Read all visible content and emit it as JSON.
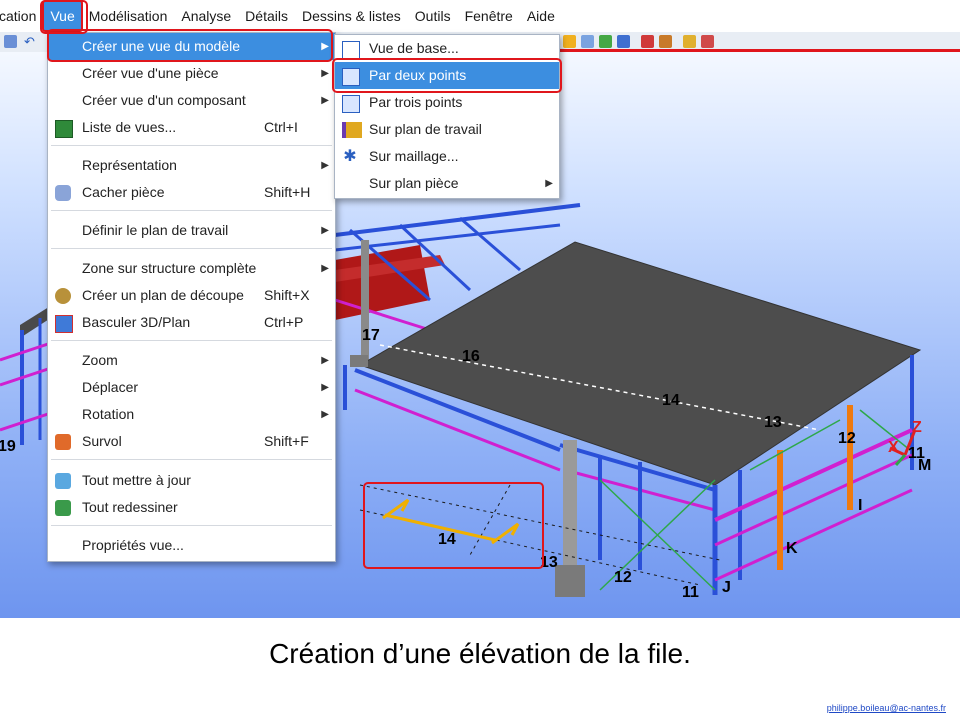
{
  "menubar": {
    "items": [
      "cation",
      "Vue",
      "Modélisation",
      "Analyse",
      "Détails",
      "Dessins & listes",
      "Outils",
      "Fenêtre",
      "Aide"
    ]
  },
  "vue_menu": {
    "items": [
      {
        "label": "Créer une vue du modèle",
        "shortcut": "",
        "arrow": "▶"
      },
      {
        "label": "Créer vue d'une pièce",
        "shortcut": "",
        "arrow": "▶"
      },
      {
        "label": "Créer vue d'un composant",
        "shortcut": "",
        "arrow": "▶"
      },
      {
        "label": "Liste de vues...",
        "shortcut": "Ctrl+I",
        "arrow": ""
      },
      {
        "label": "Représentation",
        "shortcut": "",
        "arrow": "▶"
      },
      {
        "label": "Cacher pièce",
        "shortcut": "Shift+H",
        "arrow": ""
      },
      {
        "label": "Définir le plan de travail",
        "shortcut": "",
        "arrow": "▶"
      },
      {
        "label": "Zone sur structure complète",
        "shortcut": "",
        "arrow": "▶"
      },
      {
        "label": "Créer un plan de découpe",
        "shortcut": "Shift+X",
        "arrow": ""
      },
      {
        "label": "Basculer 3D/Plan",
        "shortcut": "Ctrl+P",
        "arrow": ""
      },
      {
        "label": "Zoom",
        "shortcut": "",
        "arrow": "▶"
      },
      {
        "label": "Déplacer",
        "shortcut": "",
        "arrow": "▶"
      },
      {
        "label": "Rotation",
        "shortcut": "",
        "arrow": "▶"
      },
      {
        "label": "Survol",
        "shortcut": "Shift+F",
        "arrow": ""
      },
      {
        "label": "Tout mettre à jour",
        "shortcut": "",
        "arrow": ""
      },
      {
        "label": "Tout redessiner",
        "shortcut": "",
        "arrow": ""
      },
      {
        "label": "Propriétés vue...",
        "shortcut": "",
        "arrow": ""
      }
    ]
  },
  "submenu": {
    "items": [
      {
        "label": "Vue de base...",
        "arrow": ""
      },
      {
        "label": "Par deux points",
        "arrow": ""
      },
      {
        "label": "Par trois points",
        "arrow": ""
      },
      {
        "label": "Sur plan de travail",
        "arrow": ""
      },
      {
        "label": "Sur maillage...",
        "arrow": ""
      },
      {
        "label": "Sur plan pièce",
        "arrow": "▶"
      }
    ]
  },
  "model_labels": {
    "l17": "17",
    "l16": "16",
    "l14a": "14",
    "l13a": "13",
    "l12a": "12",
    "l11a": "11",
    "lM": "M",
    "lZ": "Z",
    "lX": "X",
    "lI": "I",
    "lK": "K",
    "lJ": "J",
    "l14b": "14",
    "l13b": "13",
    "l12b": "12",
    "l11b": "11",
    "l19": "19"
  },
  "caption": "Création d’une élévation de la file.",
  "email": "philippe.boileau@ac-nantes.fr",
  "colors": {
    "highlight": "#3c8ee0",
    "annotation": "#e0161c"
  }
}
